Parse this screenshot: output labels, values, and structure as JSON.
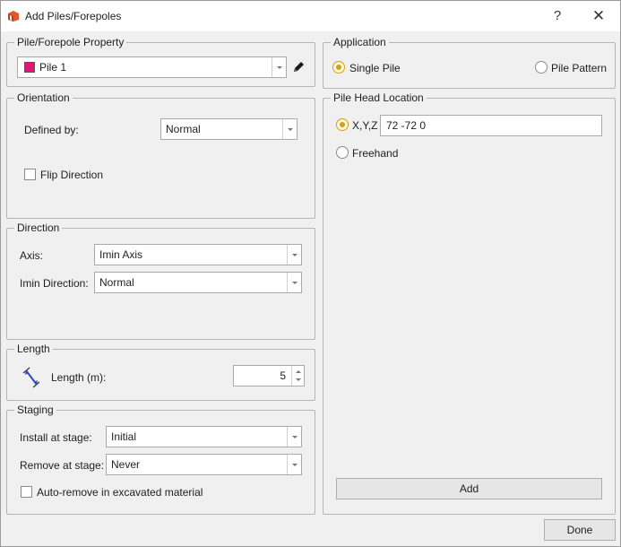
{
  "window": {
    "title": "Add Piles/Forepoles",
    "help_label": "?",
    "close_label": "✕"
  },
  "pile_property": {
    "group_label": "Pile/Forepole Property",
    "selected": "Pile 1",
    "swatch_color": "#e3137a"
  },
  "orientation": {
    "group_label": "Orientation",
    "defined_by_label": "Defined by:",
    "defined_by_value": "Normal",
    "flip_label": "Flip Direction",
    "flip_checked": false
  },
  "direction": {
    "group_label": "Direction",
    "axis_label": "Axis:",
    "axis_value": "Imin Axis",
    "imin_label": "Imin Direction:",
    "imin_value": "Normal"
  },
  "length": {
    "group_label": "Length",
    "label": "Length (m):",
    "value": "5"
  },
  "staging": {
    "group_label": "Staging",
    "install_label": "Install at stage:",
    "install_value": "Initial",
    "remove_label": "Remove at stage:",
    "remove_value": "Never",
    "auto_remove_label": "Auto-remove in excavated material",
    "auto_remove_checked": false
  },
  "application": {
    "group_label": "Application",
    "single_label": "Single Pile",
    "pattern_label": "Pile Pattern",
    "selected": "Single Pile"
  },
  "head_location": {
    "group_label": "Pile Head Location",
    "xyz_label": "X,Y,Z",
    "xyz_value": "72 -72 0",
    "freehand_label": "Freehand",
    "selected": "X,Y,Z",
    "add_label": "Add"
  },
  "footer": {
    "done_label": "Done"
  },
  "colors": {
    "radio_accent": "#d4a017",
    "pencil": "#1a1a1a",
    "length_icon": "#2b4fb5"
  }
}
